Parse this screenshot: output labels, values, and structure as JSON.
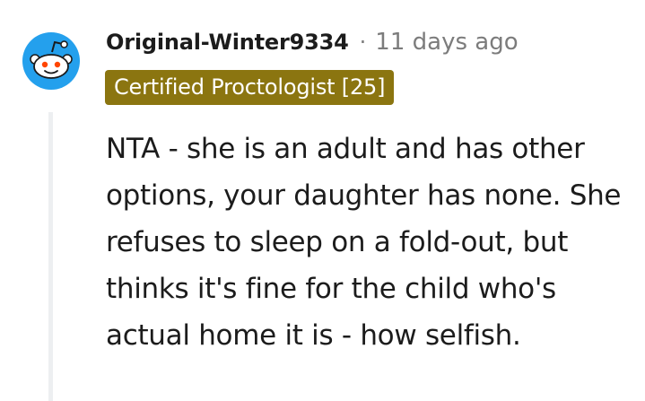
{
  "comment": {
    "username": "Original-Winter9334",
    "separator": "·",
    "timestamp": "11 days ago",
    "flair": "Certified Proctologist [25]",
    "body": "NTA - she is an adult and has other options, your daughter has none. She refuses to sleep on a fold-out, but thinks it's fine for the child who's actual home it is - how selfish."
  },
  "avatar": {
    "icon": "snoo-avatar-icon",
    "background_color": "#24a0ed"
  },
  "colors": {
    "flair_background": "#8b7510",
    "flair_text": "#ffffff",
    "username": "#1c1c1c",
    "meta": "#7c7c7c",
    "thread_line": "#edeff1"
  }
}
